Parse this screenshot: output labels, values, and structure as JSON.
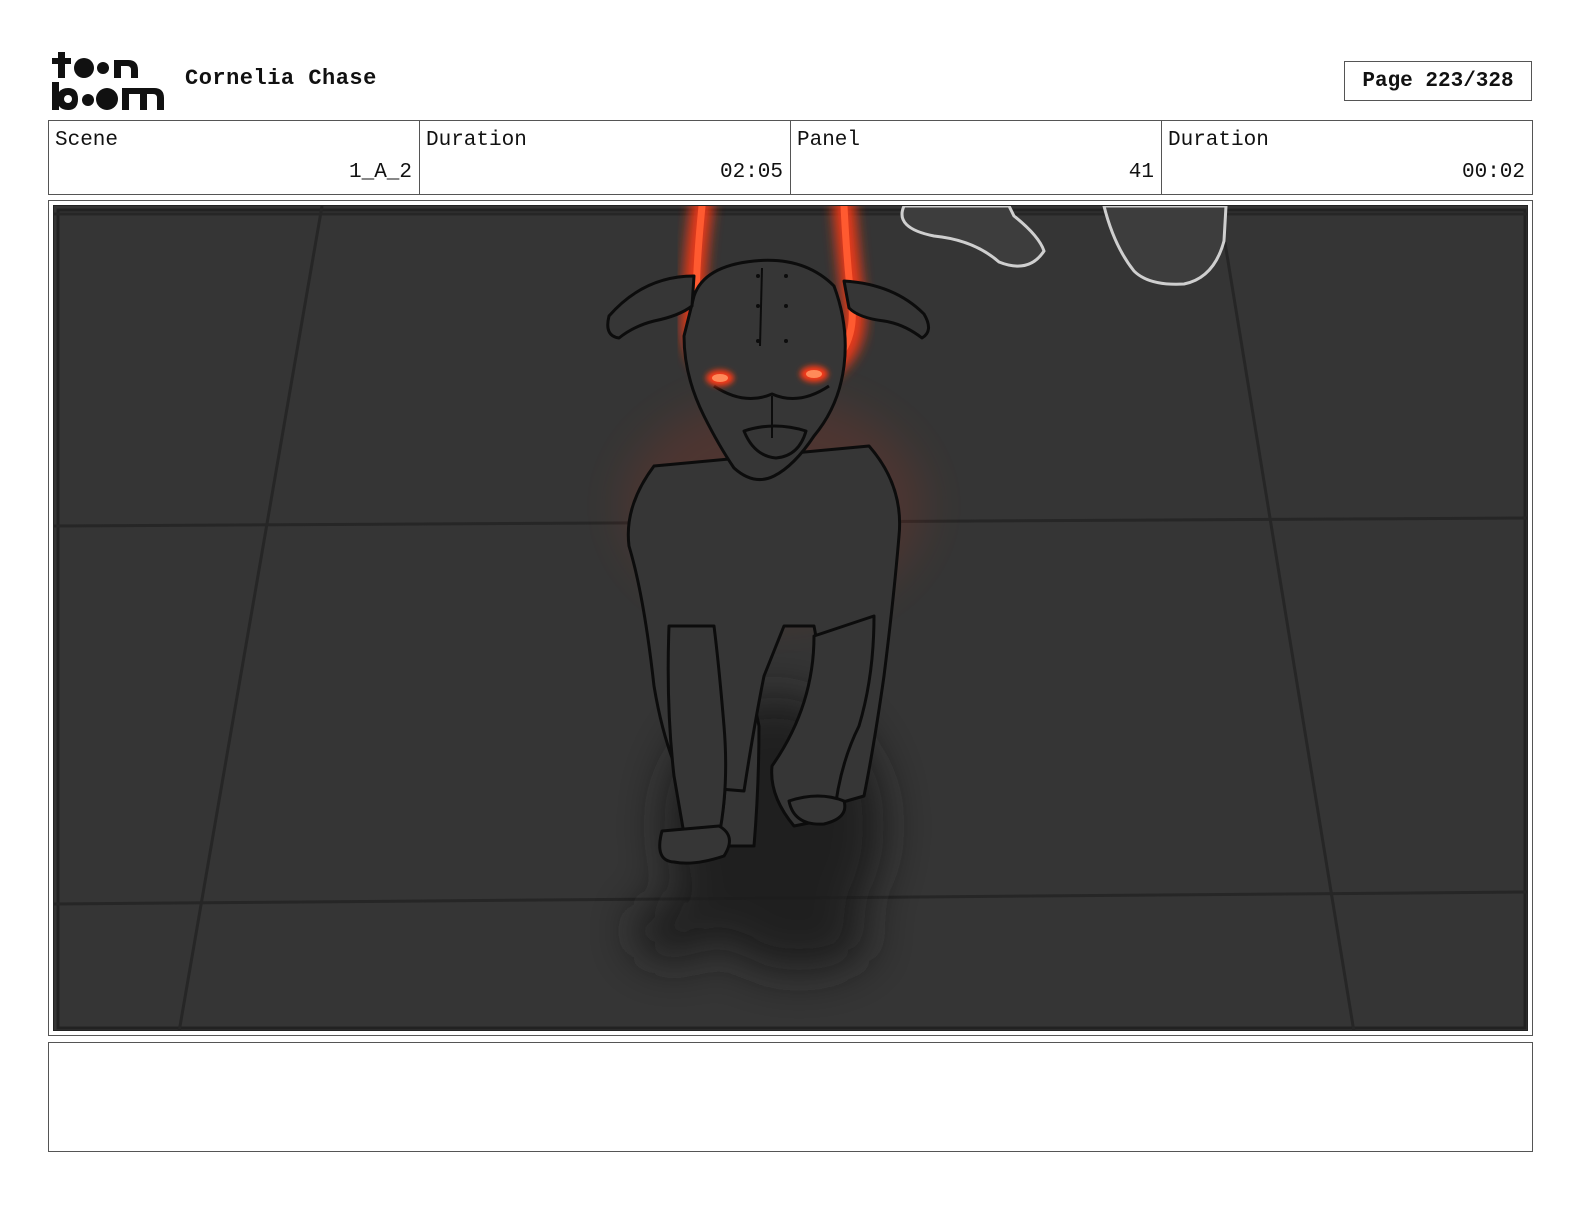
{
  "header": {
    "logo_text": "toon boom",
    "project_title": "Cornelia Chase",
    "page_label": "Page 223/328"
  },
  "info": {
    "scene_label": "Scene",
    "scene_value": "1_A_2",
    "scene_duration_label": "Duration",
    "scene_duration_value": "02:05",
    "panel_label": "Panel",
    "panel_value": "41",
    "panel_duration_label": "Duration",
    "panel_duration_value": "00:02"
  },
  "colors": {
    "background": "#353535",
    "glow": "#ff3a14",
    "ink": "#111111"
  },
  "notes": {
    "text": ""
  }
}
